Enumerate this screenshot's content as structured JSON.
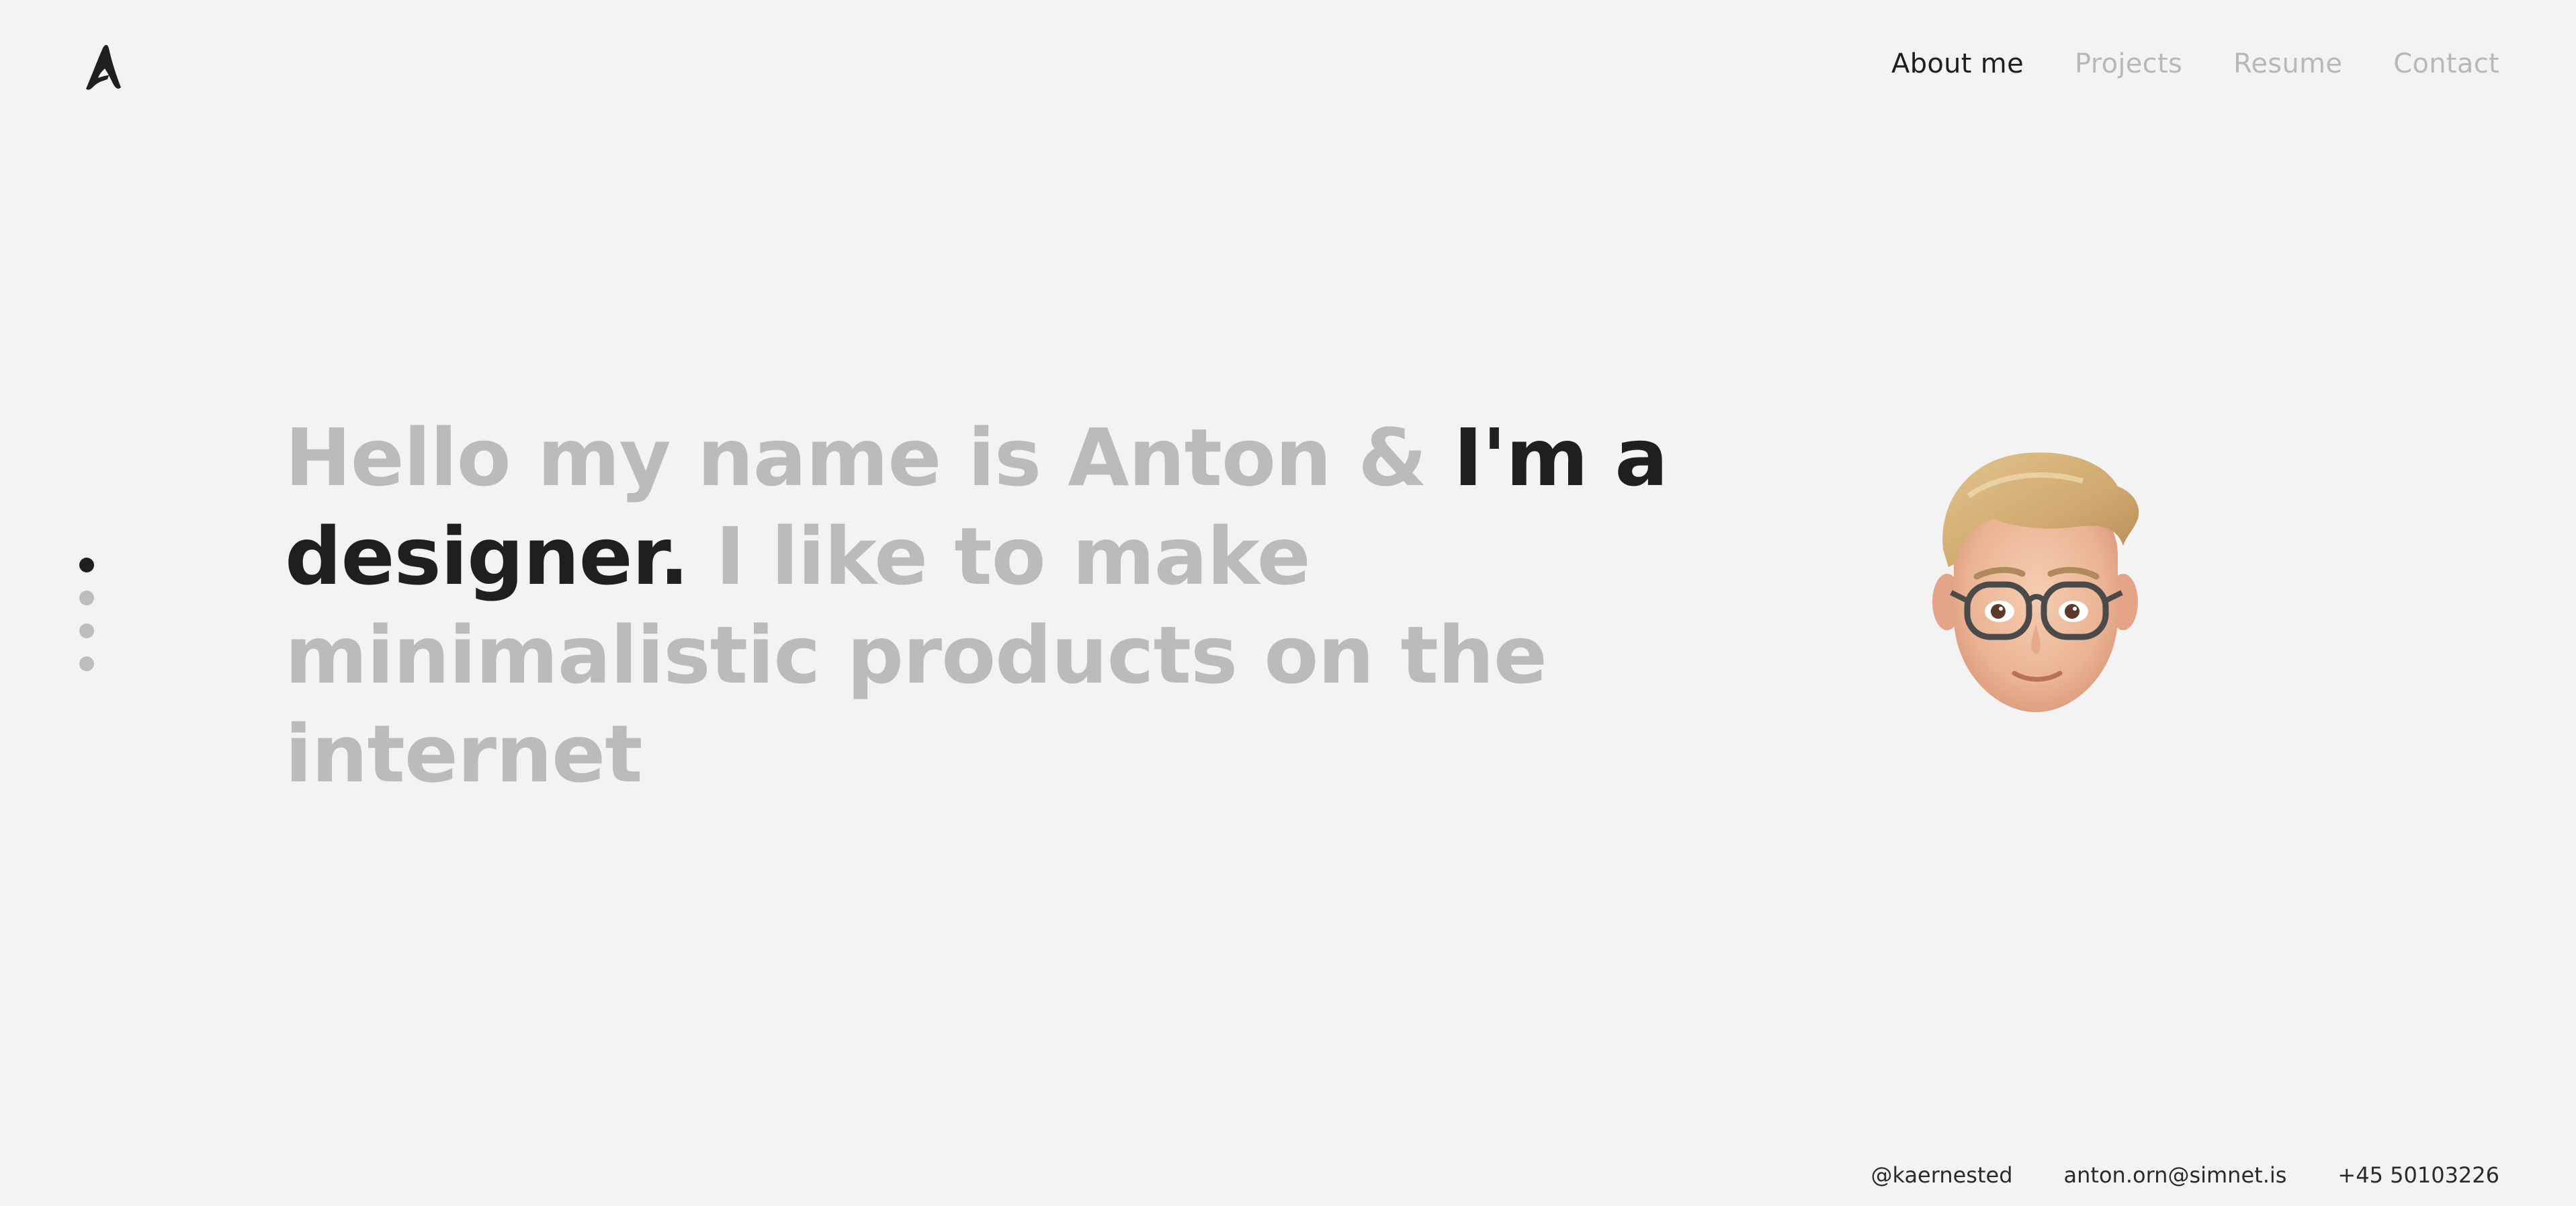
{
  "logo": {
    "icon": "letter-a-logo-icon"
  },
  "nav": {
    "items": [
      {
        "label": "About me",
        "active": true
      },
      {
        "label": "Projects",
        "active": false
      },
      {
        "label": "Resume",
        "active": false
      },
      {
        "label": "Contact",
        "active": false
      }
    ]
  },
  "pager": {
    "count": 4,
    "active_index": 0
  },
  "hero": {
    "part1": "Hello my name is Anton & ",
    "part2": "I'm a designer.",
    "part3": " I like to make minimalistic products on the internet"
  },
  "avatar": {
    "icon": "memoji-avatar-icon"
  },
  "footer": {
    "handle": "@kaernested",
    "email": "anton.orn@simnet.is",
    "phone": "+45 50103226"
  },
  "colors": {
    "background": "#f3f3f3",
    "text_dark": "#1f1f1f",
    "text_muted": "#bbbbbb"
  }
}
